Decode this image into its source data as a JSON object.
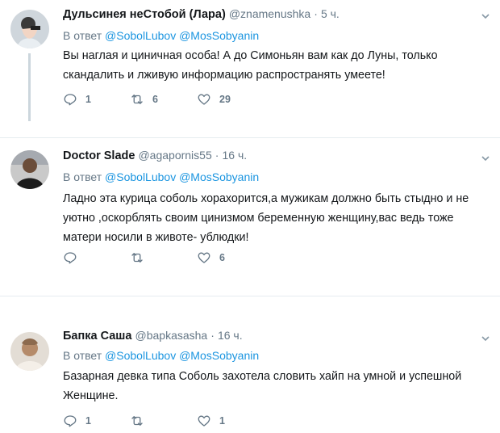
{
  "tweets": [
    {
      "name": "Дульсинея неСтобой (Лара)",
      "handle": "@znamenushka",
      "time": "5 ч.",
      "reply_prefix": "В ответ",
      "reply_to": [
        "@SobolLubov",
        "@MosSobyanin"
      ],
      "text_lines": [
        "Вы наглая  и циничная особа! А до Симоньян вам как до Луны, только",
        "скандалить и лживую информацию распространять умеете!"
      ],
      "replies": "1",
      "retweets": "6",
      "likes": "29"
    },
    {
      "name": "Doctor Slade",
      "handle": "@agapornis55",
      "time": "16 ч.",
      "reply_prefix": "В ответ",
      "reply_to": [
        "@SobolLubov",
        "@MosSobyanin"
      ],
      "text_lines": [
        "Ладно эта курица соболь хорахорится,а мужикам должно быть стыдно и не",
        "уютно ,оскорблять своим цинизмом беременную женщину,вас ведь тоже",
        "матери носили в животе- ублюдки!"
      ],
      "replies": "",
      "retweets": "",
      "likes": "6"
    },
    {
      "name": "Бапка Саша",
      "handle": "@bapkasasha",
      "time": "16 ч.",
      "reply_prefix": "В ответ",
      "reply_to": [
        "@SobolLubov",
        "@MosSobyanin"
      ],
      "text_lines": [
        "Базарная девка типа Соболь захотела словить хайп на умной и успешной",
        "Женщине."
      ],
      "replies": "1",
      "retweets": "",
      "likes": "1"
    }
  ],
  "separator_dot": "·",
  "colors": {
    "accent": "#1b95e0",
    "muted": "#657786",
    "text": "#14171a",
    "divider": "#e6ecf0"
  }
}
